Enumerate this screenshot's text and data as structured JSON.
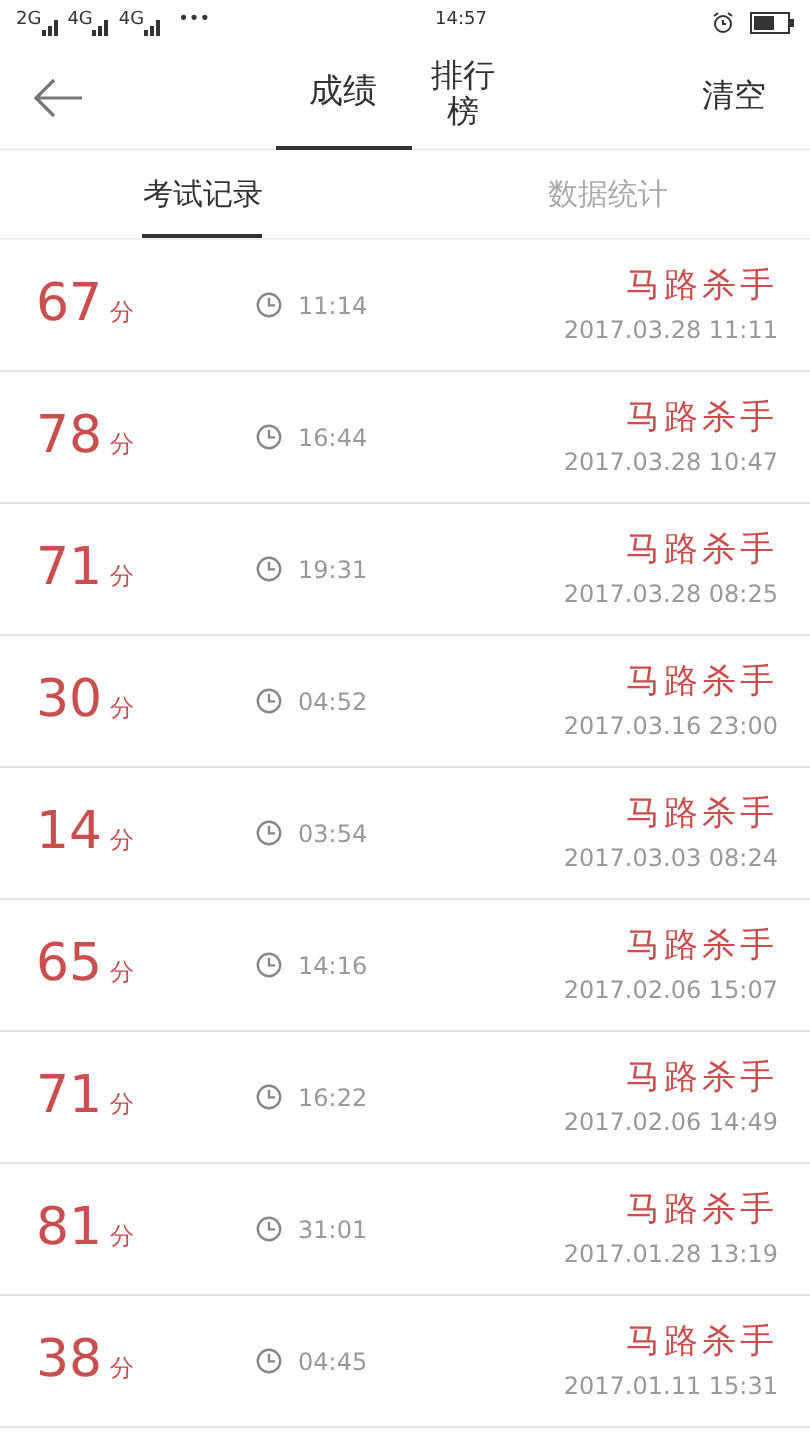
{
  "status_bar": {
    "networks": [
      "2G",
      "4G",
      "4G"
    ],
    "more": "•••",
    "time": "14:57"
  },
  "header": {
    "tabs": [
      {
        "label": "成绩",
        "selected": true
      },
      {
        "label": "排行榜",
        "selected": false
      }
    ],
    "action": "清空"
  },
  "sub_tabs": [
    {
      "label": "考试记录",
      "selected": true
    },
    {
      "label": "数据统计",
      "selected": false
    }
  ],
  "records": [
    {
      "score": "67",
      "unit": "分",
      "duration": "11:14",
      "title": "马路杀手",
      "date": "2017.03.28 11:11"
    },
    {
      "score": "78",
      "unit": "分",
      "duration": "16:44",
      "title": "马路杀手",
      "date": "2017.03.28 10:47"
    },
    {
      "score": "71",
      "unit": "分",
      "duration": "19:31",
      "title": "马路杀手",
      "date": "2017.03.28 08:25"
    },
    {
      "score": "30",
      "unit": "分",
      "duration": "04:52",
      "title": "马路杀手",
      "date": "2017.03.16 23:00"
    },
    {
      "score": "14",
      "unit": "分",
      "duration": "03:54",
      "title": "马路杀手",
      "date": "2017.03.03 08:24"
    },
    {
      "score": "65",
      "unit": "分",
      "duration": "14:16",
      "title": "马路杀手",
      "date": "2017.02.06 15:07"
    },
    {
      "score": "71",
      "unit": "分",
      "duration": "16:22",
      "title": "马路杀手",
      "date": "2017.02.06 14:49"
    },
    {
      "score": "81",
      "unit": "分",
      "duration": "31:01",
      "title": "马路杀手",
      "date": "2017.01.28 13:19"
    },
    {
      "score": "38",
      "unit": "分",
      "duration": "04:45",
      "title": "马路杀手",
      "date": "2017.01.11 15:31"
    }
  ]
}
